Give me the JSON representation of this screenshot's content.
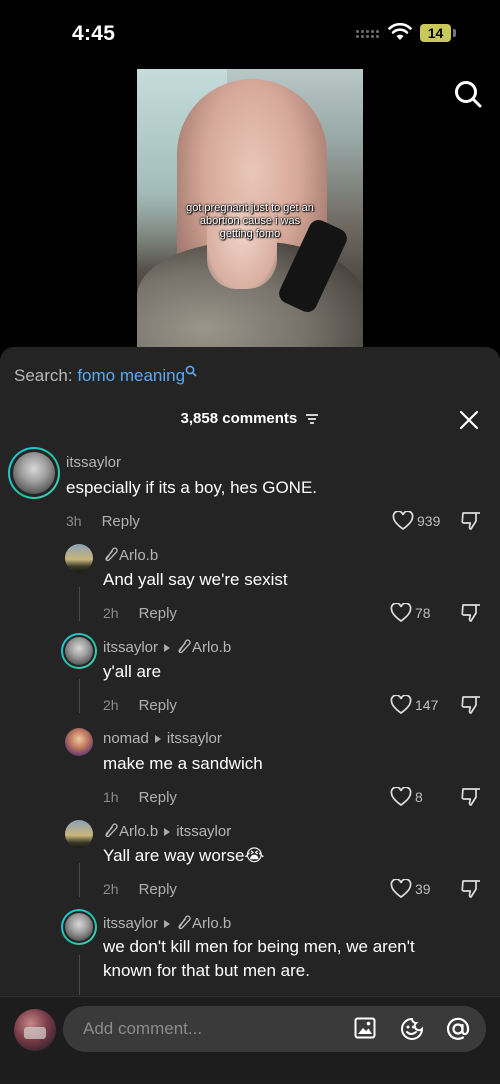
{
  "status": {
    "time": "4:45",
    "battery": "14"
  },
  "video": {
    "caption_lines": [
      "got pregnant just to get an",
      "abortion cause i was",
      "getting fomo"
    ]
  },
  "search_suggestion": {
    "prefix": "Search: ",
    "query": "fomo meaning"
  },
  "comments_header": {
    "count_label": "3,858 comments"
  },
  "comments": [
    {
      "user": "itssaylor",
      "reply_to": "",
      "text": "especially if its a boy, hes GONE.",
      "time": "3h",
      "reply_label": "Reply",
      "likes": "939"
    },
    {
      "user": "Arlo.b",
      "reply_to": "",
      "text": "And yall say we're sexist",
      "time": "2h",
      "reply_label": "Reply",
      "likes": "78"
    },
    {
      "user": "itssaylor",
      "reply_to": "Arlo.b",
      "text": "y'all are",
      "time": "2h",
      "reply_label": "Reply",
      "likes": "147"
    },
    {
      "user": "nomad",
      "reply_to": "itssaylor",
      "text": "make me a sandwich",
      "time": "1h",
      "reply_label": "Reply",
      "likes": "8"
    },
    {
      "user": "Arlo.b",
      "reply_to": "itssaylor",
      "text": "Yall are way worse😭",
      "time": "2h",
      "reply_label": "Reply",
      "likes": "39"
    },
    {
      "user": "itssaylor",
      "reply_to": "Arlo.b",
      "text_lines": [
        "we don't kill men for being men, we aren't",
        "known for that but men are."
      ]
    }
  ],
  "composer": {
    "placeholder": "Add comment..."
  },
  "icons": {
    "search": "search-icon",
    "close": "close-icon",
    "filter": "filter-icon",
    "heart": "heart-icon",
    "dislike": "dislike-icon",
    "image": "image-icon",
    "emoji": "emoji-icon",
    "mention": "at-icon",
    "arlo_prefix": "paperclip-glyph"
  },
  "colors": {
    "accent_link": "#5aa9f5",
    "sheet_bg": "#242424",
    "ring": "#1ec8e6"
  }
}
